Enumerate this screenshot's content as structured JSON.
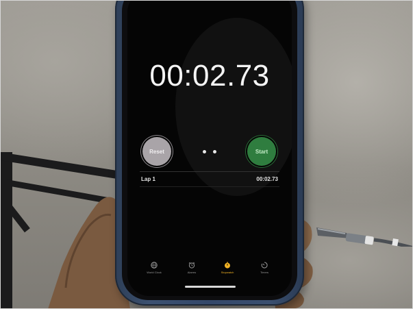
{
  "stopwatch": {
    "time": "00:02.73",
    "reset_label": "Reset",
    "start_label": "Start",
    "laps": [
      {
        "label": "Lap 1",
        "time": "00:02.73"
      }
    ]
  },
  "tabbar": {
    "items": [
      {
        "label": "World Clock",
        "icon": "globe-icon",
        "active": false
      },
      {
        "label": "Alarms",
        "icon": "alarm-clock-icon",
        "active": false
      },
      {
        "label": "Stopwatch",
        "icon": "stopwatch-icon",
        "active": true
      },
      {
        "label": "Timers",
        "icon": "timer-icon",
        "active": false
      }
    ]
  },
  "colors": {
    "screen_background": "#050505",
    "start_button": "#2f7d3f",
    "reset_button": "#a9a4a8",
    "active_tab": "#f2b325",
    "inactive_tab": "#9a9a9a",
    "phone_case": "#3c5170"
  }
}
